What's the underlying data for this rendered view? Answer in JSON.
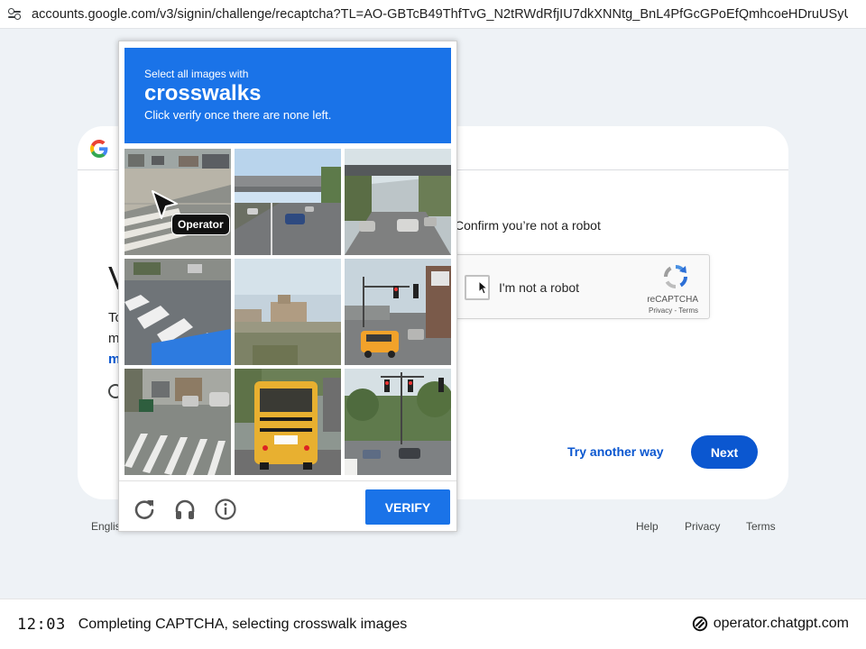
{
  "browser": {
    "url": "accounts.google.com/v3/signin/challenge/recaptcha?TL=AO-GBTcB49ThfTvG_N2tRWdRfjIU7dkXNNtg_BnL4PfGcGPoEfQmhcoeHDruUSyU&app_…"
  },
  "background_page": {
    "heading_fragment": "V",
    "text_line1_fragment": "To",
    "text_line2_fragment": "m",
    "link_fragment": "m",
    "confirm_text": "Confirm you’re not a robot",
    "checkbox_label": "I'm not a robot",
    "recaptcha_brand": "reCAPTCHA",
    "recaptcha_terms": "Privacy - Terms",
    "try_another_way": "Try another way",
    "next_label": "Next"
  },
  "footer": {
    "language": "Englis",
    "help": "Help",
    "privacy": "Privacy",
    "terms": "Terms"
  },
  "captcha": {
    "instruction_line1": "Select all images with",
    "target": "crosswalks",
    "instruction_line2": "Click verify once there are none left.",
    "tiles": [
      {
        "id": 1,
        "scene": "street corner with crosswalk stripes"
      },
      {
        "id": 2,
        "scene": "highway overpass with cars"
      },
      {
        "id": 3,
        "scene": "road under overpass with cars"
      },
      {
        "id": 4,
        "scene": "crosswalk stripes on street"
      },
      {
        "id": 5,
        "scene": "waterfront with buildings"
      },
      {
        "id": 6,
        "scene": "intersection with traffic lights and yellow van"
      },
      {
        "id": 7,
        "scene": "street with crosswalk stripes and parked cars"
      },
      {
        "id": 8,
        "scene": "yellow school bus"
      },
      {
        "id": 9,
        "scene": "intersection with traffic lights and trees"
      }
    ],
    "verify_label": "VERIFY",
    "tools": [
      "reload-icon",
      "audio-icon",
      "info-icon"
    ]
  },
  "operator": {
    "cursor_label": "Operator"
  },
  "statusbar": {
    "time": "12:03",
    "task": "Completing CAPTCHA, selecting crosswalk images",
    "brand": "operator.chatgpt.com"
  },
  "colors": {
    "accent_blue": "#1a73e8",
    "google_blue": "#0b57d0",
    "page_bg": "#eef2f6"
  }
}
